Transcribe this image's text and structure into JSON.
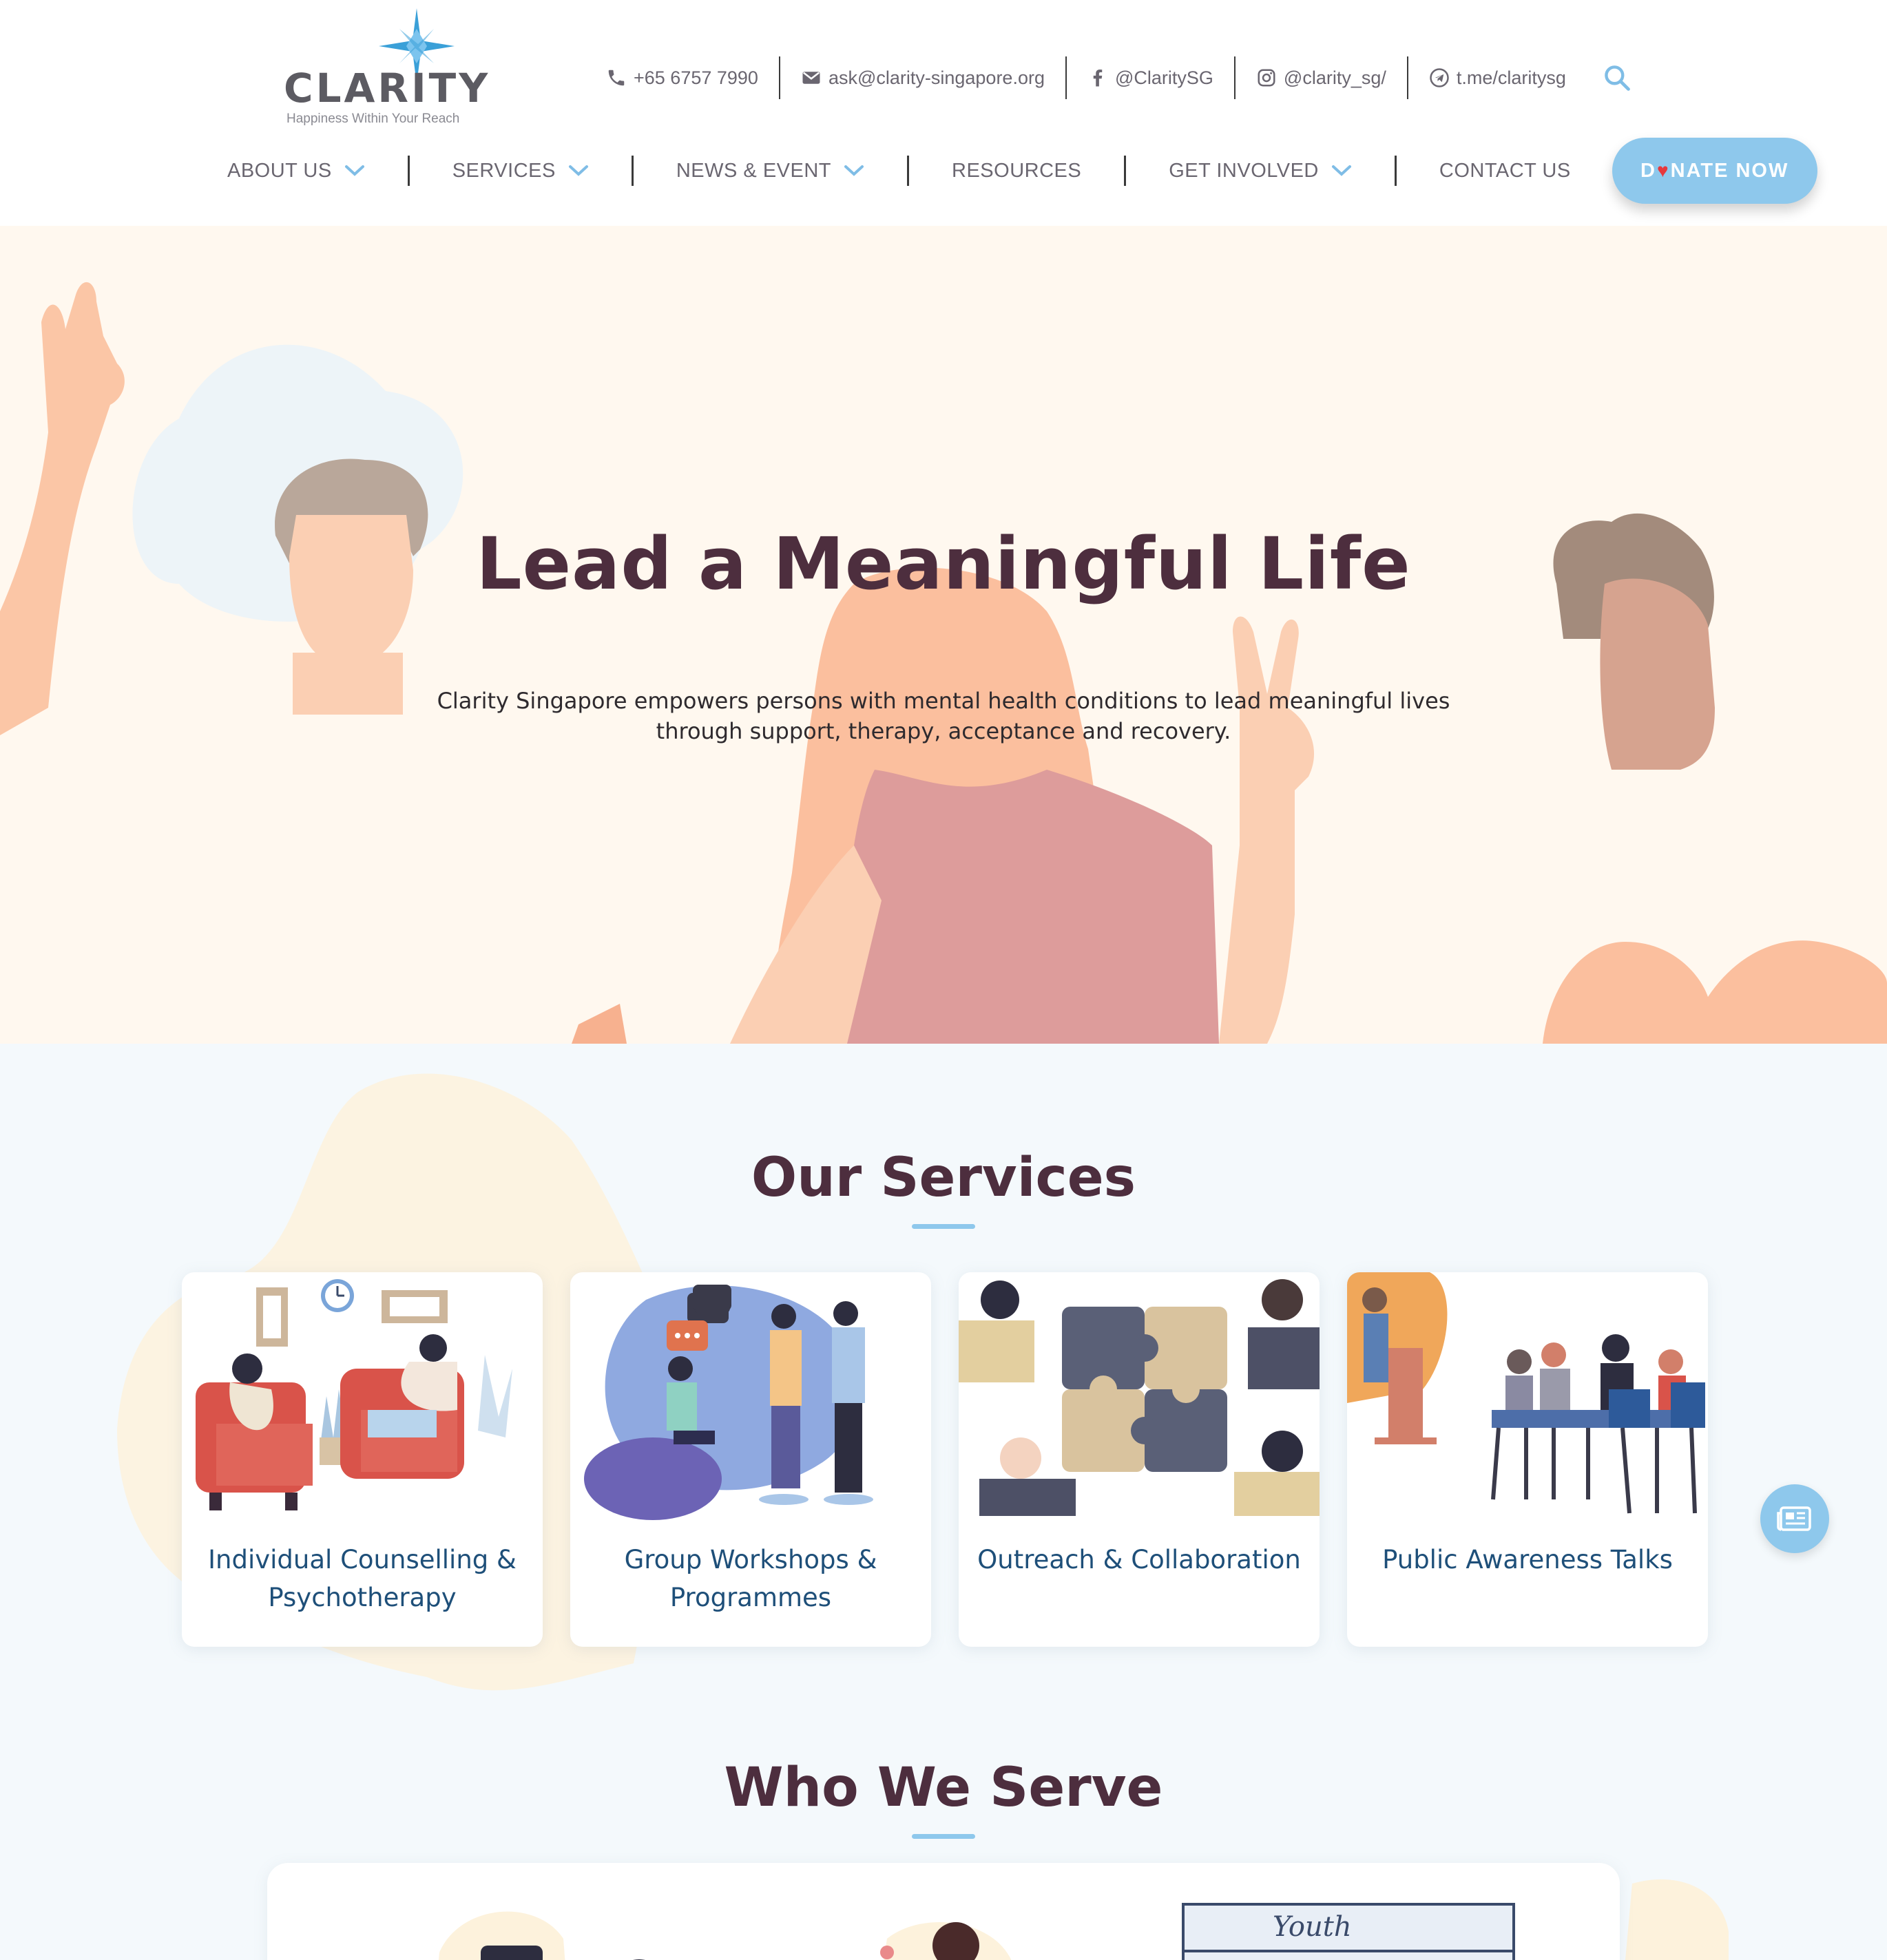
{
  "brand": {
    "logo_text": "CLARITY",
    "logo_tagline": "Happiness Within Your Reach",
    "star_color": "#3aa0d8"
  },
  "topbar": {
    "phone": "+65 6757 7990",
    "email": "ask@clarity-singapore.org",
    "facebook": "@ClaritySG",
    "instagram": "@clarity_sg/",
    "telegram": "t.me/claritysg",
    "icons": [
      "phone-icon",
      "mail-icon",
      "facebook-icon",
      "instagram-icon",
      "telegram-icon",
      "search-icon"
    ]
  },
  "nav": {
    "items": [
      {
        "label": "ABOUT US",
        "dropdown": true
      },
      {
        "label": "SERVICES",
        "dropdown": true
      },
      {
        "label": "NEWS & EVENT",
        "dropdown": true
      },
      {
        "label": "RESOURCES",
        "dropdown": false
      },
      {
        "label": "GET INVOLVED",
        "dropdown": true
      },
      {
        "label": "CONTACT US",
        "dropdown": false
      }
    ],
    "donate_prefix": "D",
    "donate_heart": "♥",
    "donate_suffix": "NATE NOW"
  },
  "hero": {
    "title": "Lead a Meaningful Life",
    "description": "Clarity Singapore empowers persons with mental health conditions to lead meaningful lives through support, therapy, acceptance and recovery."
  },
  "services": {
    "title": "Our Services",
    "cards": [
      {
        "label": "Individual Counselling & Psychotherapy"
      },
      {
        "label": "Group Workshops & Programmes"
      },
      {
        "label": "Outreach & Collaboration"
      },
      {
        "label": "Public Awareness Talks"
      }
    ]
  },
  "who_we_serve": {
    "title": "Who We Serve",
    "banner_text": "Youth"
  },
  "colors": {
    "accent": "#8ec8ec",
    "heading": "#4d2e3e",
    "card_label": "#1e4f79",
    "hero_bg": "#fff8ef",
    "section_bg": "#f4f9fc"
  }
}
